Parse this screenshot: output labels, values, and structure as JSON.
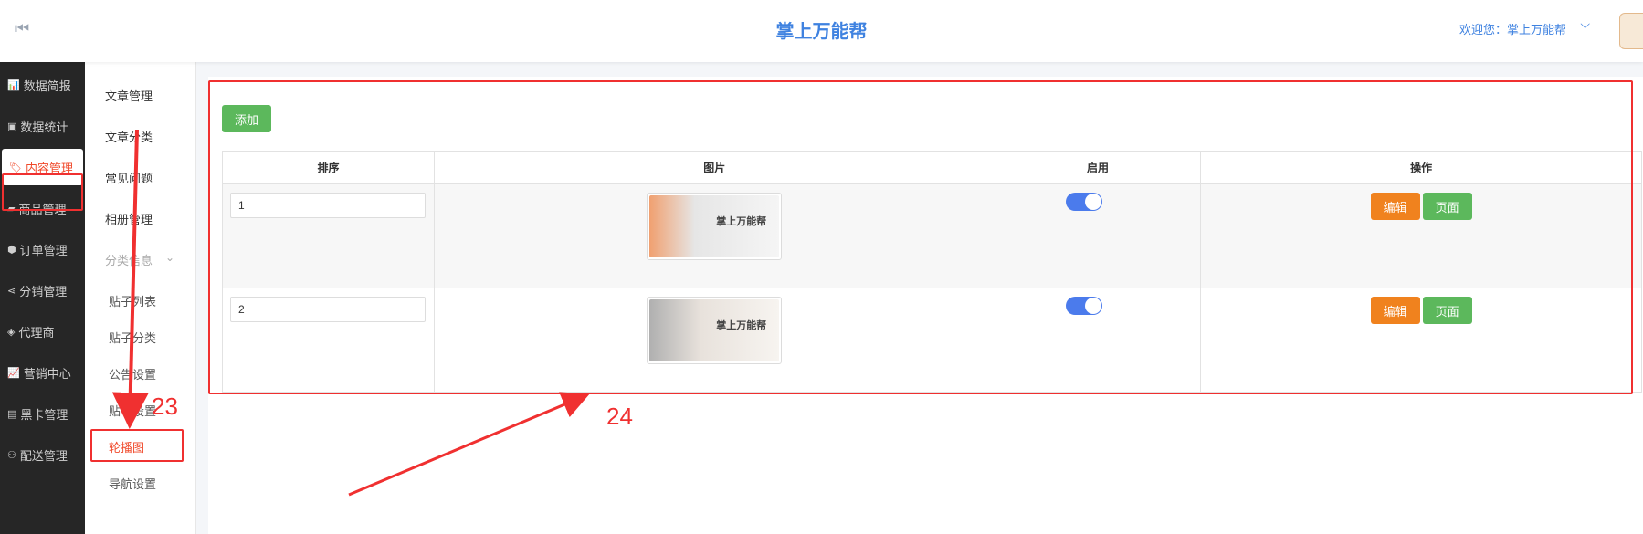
{
  "header": {
    "title": "掌上万能帮",
    "welcome": "欢迎您：掌上万能帮"
  },
  "sidebar": {
    "items": [
      {
        "label": "数据简报",
        "icon": "bar-chart-icon"
      },
      {
        "label": "数据统计",
        "icon": "monitor-icon"
      },
      {
        "label": "内容管理",
        "icon": "tag-icon",
        "active": true
      },
      {
        "label": "商品管理",
        "icon": "bag-icon"
      },
      {
        "label": "订单管理",
        "icon": "order-icon"
      },
      {
        "label": "分销管理",
        "icon": "share-icon"
      },
      {
        "label": "代理商",
        "icon": "diamond-icon"
      },
      {
        "label": "营销中心",
        "icon": "line-chart-icon"
      },
      {
        "label": "黑卡管理",
        "icon": "card-icon"
      },
      {
        "label": "配送管理",
        "icon": "bike-icon"
      }
    ]
  },
  "submenu": {
    "items": [
      {
        "label": "文章管理"
      },
      {
        "label": "文章分类"
      },
      {
        "label": "常见问题"
      },
      {
        "label": "相册管理"
      },
      {
        "label": "分类信息",
        "group": true
      },
      {
        "label": "贴子列表"
      },
      {
        "label": "贴子分类"
      },
      {
        "label": "公告设置"
      },
      {
        "label": "贴子设置"
      },
      {
        "label": "轮播图",
        "active": true
      },
      {
        "label": "导航设置"
      }
    ]
  },
  "main": {
    "add_label": "添加",
    "columns": [
      "排序",
      "图片",
      "启用",
      "操作"
    ],
    "rows": [
      {
        "sort": "1",
        "image_text": "掌上万能帮",
        "enabled": true,
        "edit_label": "编辑",
        "page_label": "页面"
      },
      {
        "sort": "2",
        "image_text": "掌上万能帮",
        "enabled": true,
        "edit_label": "编辑",
        "page_label": "页面"
      }
    ]
  },
  "annotations": {
    "label_23": "23",
    "label_24": "24",
    "color": "#f03030"
  },
  "colors": {
    "accent": "#3f82e0",
    "active": "#f04a2b",
    "green": "#5cb85c",
    "orange": "#f0821e",
    "toggle": "#4b7bec"
  }
}
